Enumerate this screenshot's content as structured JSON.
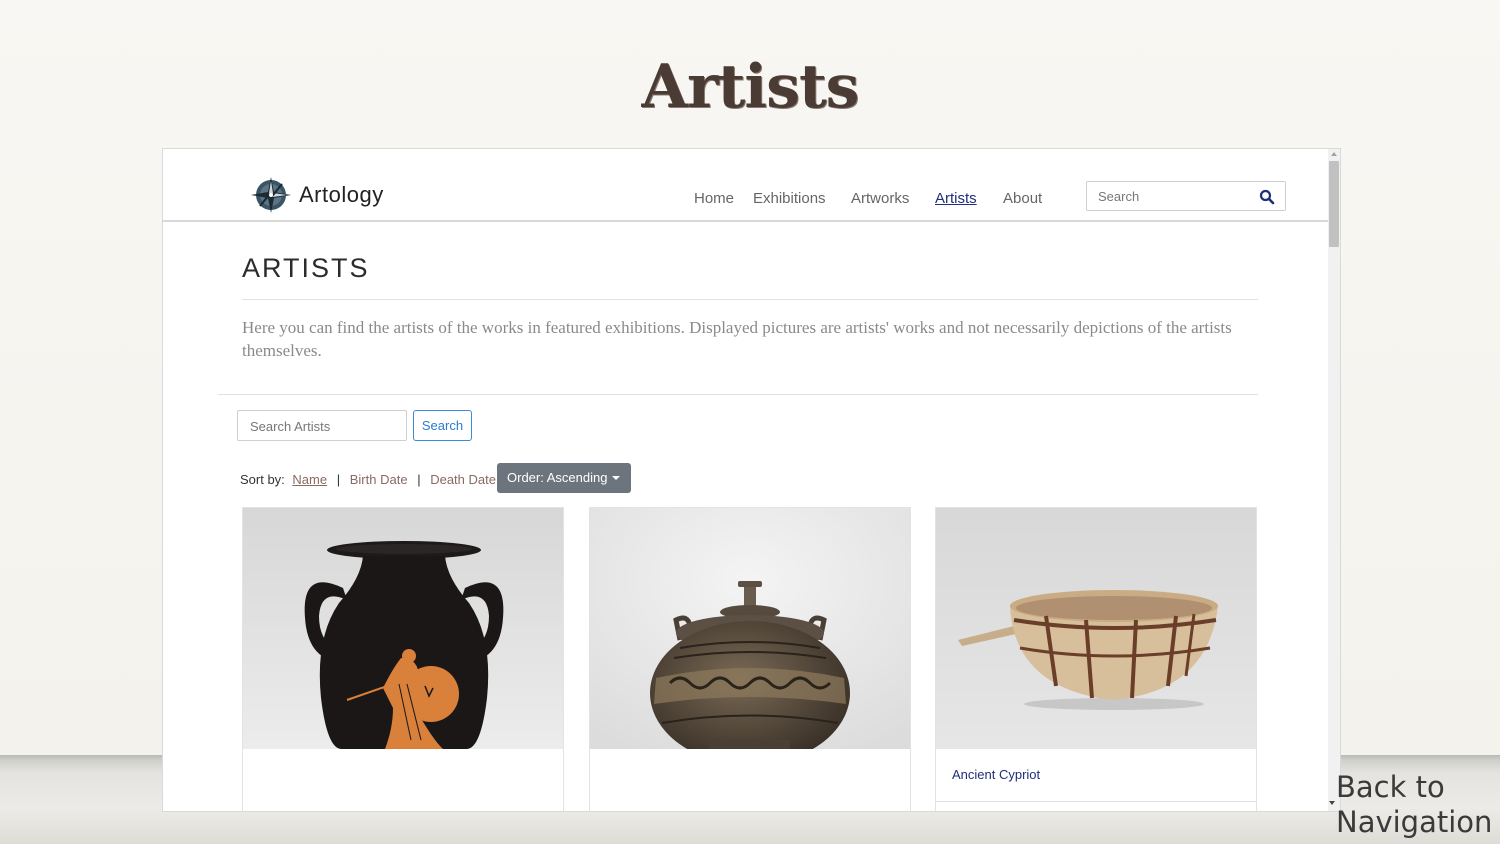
{
  "slide": {
    "title": "Artists",
    "back_to_navigation": "Back to Navigation"
  },
  "navbar": {
    "brand": "Artology",
    "logo_icon": "compass-icon",
    "links": [
      {
        "label": "Home",
        "active": false
      },
      {
        "label": "Exhibitions",
        "active": false
      },
      {
        "label": "Artworks",
        "active": false
      },
      {
        "label": "Artists",
        "active": true
      },
      {
        "label": "About",
        "active": false
      }
    ],
    "search_placeholder": "Search",
    "search_icon": "search-icon"
  },
  "main": {
    "heading": "ARTISTS",
    "intro": "Here you can find the artists of the works in featured exhibitions. Displayed pictures are artists' works and not necessarily depictions of the artists themselves.",
    "artist_search_placeholder": "Search Artists",
    "search_button": "Search",
    "sort": {
      "label": "Sort by:",
      "options": [
        {
          "label": "Name",
          "active": true
        },
        {
          "label": "Birth Date",
          "active": false
        },
        {
          "label": "Death Date",
          "active": false
        }
      ],
      "separator": "|",
      "order_button": "Order: Ascending"
    },
    "cards": [
      {
        "title": "",
        "image": "red-figure-amphora"
      },
      {
        "title": "",
        "image": "lidded-pyxis-jar"
      },
      {
        "title": "Ancient Cypriot",
        "image": "painted-bowl"
      }
    ]
  },
  "colors": {
    "active_link": "#1f2f7a",
    "order_button": "#6c757d",
    "search_button_border": "#3b8bd6"
  }
}
